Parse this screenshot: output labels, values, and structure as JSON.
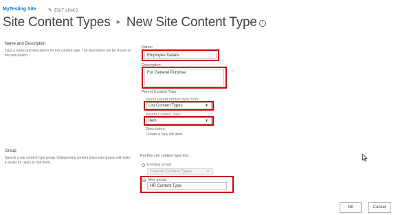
{
  "header": {
    "site_link": "MyTesting Site",
    "edit_links": "EDIT LINKS",
    "breadcrumb_root": "Site Content Types",
    "breadcrumb_separator": "▸",
    "page_title": "New Site Content Type",
    "info_icon": "info-icon"
  },
  "name_section": {
    "title": "Name and Description",
    "description": "Type a name and description for this content type. The description will be shown on the new button.",
    "name_label": "Name:",
    "name_value": "Employee Details",
    "description_label": "Description:",
    "description_value": "For General Purpose",
    "parent_content_type_label": "Parent Content Type:",
    "select_parent_from_label": "Select parent content type from:",
    "parent_group_value": "List Content Types",
    "parent_content_type_sublabel": "Parent Content Type:",
    "parent_type_value": "Item",
    "desc_label": "Description:",
    "desc_text": "Create a new list item."
  },
  "group_section": {
    "title": "Group",
    "description": "Specify a site content type group. Categorizing content types into groups will make it easier for users to find them.",
    "put_into_label": "Put this site content type into:",
    "existing_group_label": "Existing group:",
    "existing_group_value": "Custom Content Types",
    "new_group_label": "New group:",
    "new_group_value": "HR Content Type",
    "selected_option": "new_group"
  },
  "buttons": {
    "ok": "OK",
    "cancel": "Cancel"
  },
  "colors": {
    "link": "#0072c6",
    "highlight": "#cc0000"
  }
}
